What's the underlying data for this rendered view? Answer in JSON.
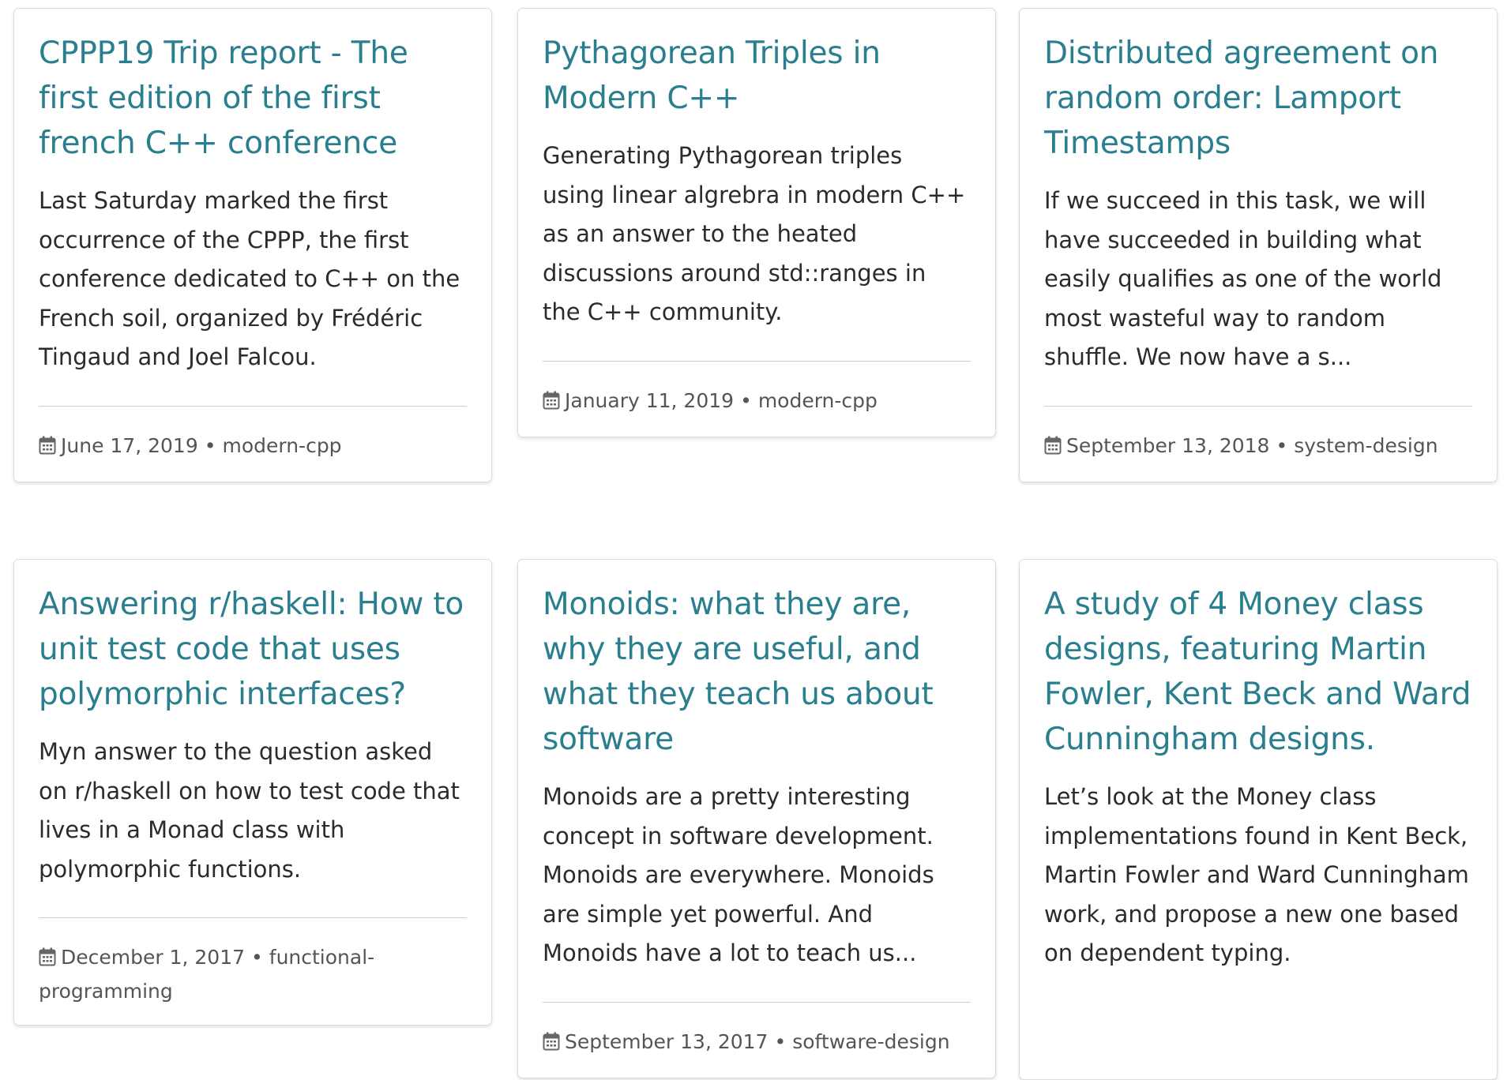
{
  "cards": [
    {
      "title": "CPPP19 Trip report - The first edition of the first french C++ conference",
      "excerpt": "Last Saturday marked the first occurrence of the CPPP, the first conference dedicated to C++ on the French soil, organized by Frédéric Tingaud and Joel Falcou.",
      "date": "June 17, 2019",
      "tag": "modern-cpp"
    },
    {
      "title": "Pythagorean Triples in Modern C++",
      "excerpt": "Generating Pythagorean triples using linear algrebra in modern C++ as an answer to the heated discussions around std::ranges in the C++ community.",
      "date": "January 11, 2019",
      "tag": "modern-cpp"
    },
    {
      "title": "Distributed agreement on random order: Lamport Timestamps",
      "excerpt": "If we succeed in this task, we will have succeeded in building what easily qualifies as one of the world most wasteful way to random shuffle. We now have a s...",
      "date": "September 13, 2018",
      "tag": "system-design"
    },
    {
      "title": "Answering r/haskell: How to unit test code that uses polymorphic interfaces?",
      "excerpt": "Myn answer to the question asked on r/haskell on how to test code that lives in a Monad class with polymorphic functions.",
      "date": "December 1, 2017",
      "tag": "functional-programming"
    },
    {
      "title": "Monoids: what they are, why they are useful, and what they teach us about software",
      "excerpt": "Monoids are a pretty interesting concept in software development. Monoids are everywhere. Monoids are simple yet powerful. And Monoids have a lot to teach us...",
      "date": "September 13, 2017",
      "tag": "software-design"
    },
    {
      "title": "A study of 4 Money class designs, featuring Martin Fowler, Kent Beck and Ward Cunningham designs.",
      "excerpt": "Let’s look at the Money class implementations found in Kent Beck, Martin Fowler and Ward Cunningham work, and propose a new one based on dependent typing.",
      "date": "",
      "tag": ""
    }
  ],
  "meta_separator": "•",
  "icons": {
    "date": "calendar-icon"
  },
  "colors": {
    "title_link": "#2a7f8f",
    "body_text": "#2b2b2b",
    "meta_text": "#555555",
    "divider": "#cfcfcf"
  }
}
